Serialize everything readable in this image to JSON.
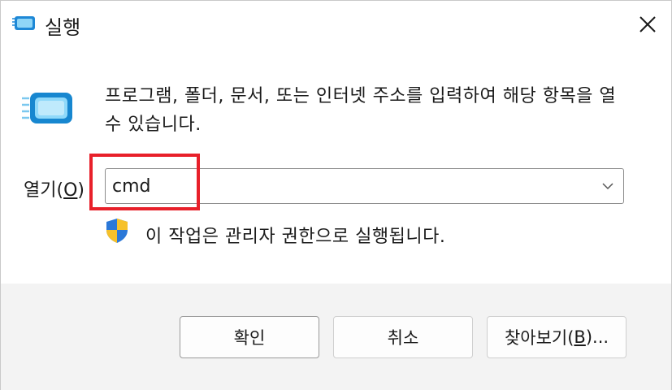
{
  "window": {
    "title": "실행",
    "close_icon": "close-icon"
  },
  "body": {
    "description": "프로그램, 폴더, 문서, 또는 인터넷 주소를 입력하여 해당 항목을 열 수 있습니다.",
    "open_label_prefix": "열기(",
    "open_label_accel": "O",
    "open_label_suffix": ")",
    "input_value": "cmd",
    "admin_note": "이 작업은 관리자 권한으로 실행됩니다."
  },
  "buttons": {
    "ok": "확인",
    "cancel": "취소",
    "browse_prefix": "찾아보기(",
    "browse_accel": "B",
    "browse_suffix": ")..."
  },
  "colors": {
    "highlight": "#e8202a",
    "footer_bg": "#f3f3f3",
    "icon_blue": "#2ea8e6"
  }
}
